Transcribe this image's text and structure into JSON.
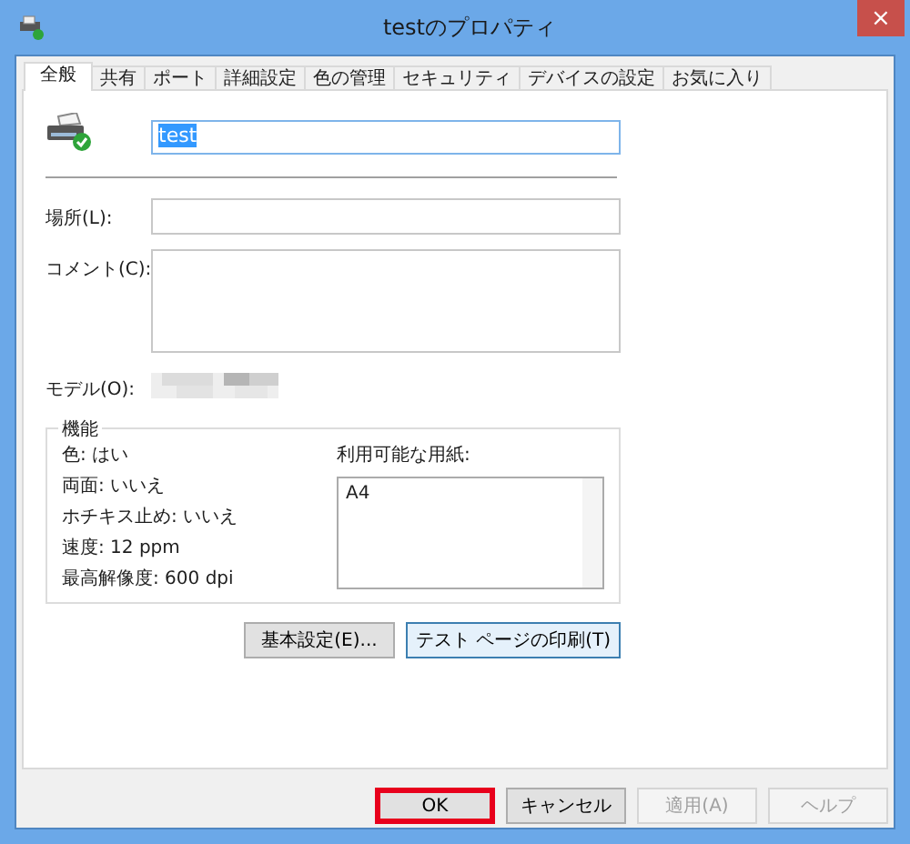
{
  "window": {
    "title": "testのプロパティ",
    "close": "×"
  },
  "tabs": [
    {
      "label": "全般",
      "selected": true
    },
    {
      "label": "共有",
      "selected": false
    },
    {
      "label": "ポート",
      "selected": false
    },
    {
      "label": "詳細設定",
      "selected": false
    },
    {
      "label": "色の管理",
      "selected": false
    },
    {
      "label": "セキュリティ",
      "selected": false
    },
    {
      "label": "デバイスの設定",
      "selected": false
    },
    {
      "label": "お気に入り",
      "selected": false
    }
  ],
  "name_field": {
    "value": "test",
    "selected": true
  },
  "location": {
    "label": "場所(L):"
  },
  "comment": {
    "label": "コメント(C):"
  },
  "model": {
    "label": "モデル(O):"
  },
  "features": {
    "title": "機能",
    "items": [
      "色: はい",
      "両面: いいえ",
      "ホチキス止め: いいえ",
      "速度: 12 ppm",
      "最高解像度: 600 dpi"
    ],
    "paper_label": "利用可能な用紙:",
    "paper_list": [
      "A4"
    ]
  },
  "panel_buttons": [
    {
      "label": "基本設定(E)...",
      "default": false
    },
    {
      "label": "テスト ページの印刷(T)",
      "default": true
    }
  ],
  "buttons": [
    {
      "label": "OK",
      "disabled": false,
      "highlighted": true
    },
    {
      "label": "キャンセル",
      "disabled": false,
      "highlighted": false
    },
    {
      "label": "適用(A)",
      "disabled": true,
      "highlighted": false
    },
    {
      "label": "ヘルプ",
      "disabled": true,
      "highlighted": false
    }
  ]
}
